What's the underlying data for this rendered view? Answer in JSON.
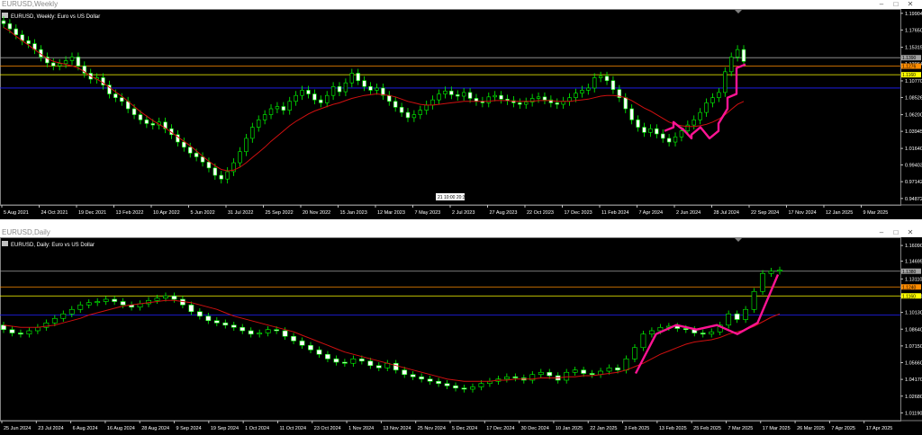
{
  "windows": [
    {
      "id": "weekly",
      "title": "EURUSD,Weekly",
      "chart_label": "EURUSD, Weekly:  Euro vs US Dollar",
      "price_labels": [
        "1.19904",
        "1.17650",
        "1.15315",
        "1.13064",
        "1.10770",
        "1.08526",
        "1.06200",
        "1.03945",
        "1.01640",
        "0.99403",
        "0.97142",
        "0.94872"
      ],
      "ylim": [
        0.94,
        1.2
      ],
      "levels": [
        {
          "price": 1.139,
          "color": "#a0a0a0",
          "tag": "1.1390"
        },
        {
          "price": 1.1276,
          "color": "#ff8c00",
          "tag": "1.1276"
        },
        {
          "price": 1.116,
          "color": "#ffff00",
          "tag": "1.1160"
        },
        {
          "price": 1.098,
          "color": "#2020ff",
          "tag": ""
        }
      ],
      "date_labels": [
        "5 Aug 2021",
        "24 Oct 2021",
        "19 Dec 2021",
        "13 Feb 2022",
        "10 Apr 2022",
        "5 Jun 2022",
        "31 Jul 2022",
        "25 Sep 2022",
        "20 Nov 2022",
        "15 Jan 2023",
        "12 Mar 2023",
        "7 May 2023",
        "2 Jul 2023",
        "27 Aug 2023",
        "22 Oct 2023",
        "17 Dec 2023",
        "11 Feb 2024",
        "7 Apr 2024",
        "2 Jun 2024",
        "28 Jul 2024",
        "22 Sep 2024",
        "17 Nov 2024",
        "12 Jan 2025",
        "9 Mar 2025"
      ],
      "crosshair_tag": "21 10:00  20:30",
      "chart_data": {
        "type": "candlestick",
        "series": [
          {
            "name": "EURUSD close",
            "values": [
              1.185,
              1.178,
              1.17,
              1.162,
              1.158,
              1.15,
              1.14,
              1.132,
              1.128,
              1.131,
              1.135,
              1.14,
              1.128,
              1.118,
              1.11,
              1.112,
              1.102,
              1.09,
              1.085,
              1.08,
              1.07,
              1.062,
              1.055,
              1.05,
              1.048,
              1.052,
              1.043,
              1.035,
              1.025,
              1.018,
              1.01,
              1.005,
              0.998,
              0.99,
              0.98,
              0.975,
              0.985,
              0.997,
              1.012,
              1.03,
              1.045,
              1.055,
              1.062,
              1.07,
              1.073,
              1.068,
              1.08,
              1.088,
              1.095,
              1.09,
              1.082,
              1.078,
              1.088,
              1.1,
              1.093,
              1.105,
              1.118,
              1.108,
              1.1,
              1.095,
              1.098,
              1.088,
              1.08,
              1.072,
              1.065,
              1.058,
              1.062,
              1.068,
              1.075,
              1.082,
              1.09,
              1.094,
              1.089,
              1.087,
              1.092,
              1.084,
              1.08,
              1.078,
              1.086,
              1.088,
              1.083,
              1.081,
              1.078,
              1.076,
              1.079,
              1.084,
              1.086,
              1.082,
              1.078,
              1.076,
              1.08,
              1.085,
              1.091,
              1.095,
              1.098,
              1.112,
              1.114,
              1.108,
              1.096,
              1.085,
              1.07,
              1.055,
              1.045,
              1.038,
              1.043,
              1.036,
              1.03,
              1.025,
              1.032,
              1.04,
              1.048,
              1.055,
              1.065,
              1.078,
              1.085,
              1.092,
              1.12,
              1.14,
              1.15,
              1.134
            ]
          },
          {
            "name": "MA",
            "values": [
              1.18,
              1.175,
              1.168,
              1.162,
              1.156,
              1.15,
              1.144,
              1.138,
              1.134,
              1.132,
              1.13,
              1.128,
              1.125,
              1.12,
              1.114,
              1.11,
              1.105,
              1.099,
              1.093,
              1.087,
              1.08,
              1.073,
              1.066,
              1.06,
              1.054,
              1.049,
              1.044,
              1.038,
              1.032,
              1.026,
              1.02,
              1.013,
              1.006,
              0.999,
              0.993,
              0.988,
              0.986,
              0.987,
              0.991,
              0.997,
              1.004,
              1.011,
              1.018,
              1.026,
              1.033,
              1.04,
              1.047,
              1.053,
              1.058,
              1.063,
              1.067,
              1.07,
              1.073,
              1.076,
              1.078,
              1.081,
              1.084,
              1.086,
              1.088,
              1.089,
              1.09,
              1.089,
              1.088,
              1.086,
              1.083,
              1.08,
              1.078,
              1.076,
              1.075,
              1.075,
              1.076,
              1.077,
              1.078,
              1.079,
              1.08,
              1.08,
              1.08,
              1.08,
              1.08,
              1.081,
              1.081,
              1.081,
              1.08,
              1.08,
              1.08,
              1.08,
              1.081,
              1.081,
              1.081,
              1.08,
              1.08,
              1.08,
              1.081,
              1.082,
              1.083,
              1.085,
              1.087,
              1.088,
              1.088,
              1.087,
              1.085,
              1.081,
              1.076,
              1.071,
              1.067,
              1.062,
              1.057,
              1.052,
              1.049,
              1.047,
              1.046,
              1.046,
              1.047,
              1.049,
              1.052,
              1.056,
              1.062,
              1.069,
              1.076,
              1.08
            ]
          }
        ],
        "drawing": [
          [
            1.04,
            1.045
          ],
          [
            1.052,
            1.042
          ],
          [
            1.043,
            1.03
          ],
          [
            1.035,
            1.045
          ],
          [
            1.045,
            1.03
          ],
          [
            1.03,
            1.04
          ],
          [
            1.05,
            1.07
          ],
          [
            1.085,
            1.09
          ],
          [
            1.125,
            1.13
          ]
        ]
      }
    },
    {
      "id": "daily",
      "title": "EURUSD,Daily",
      "chart_label": "EURUSD, Daily:  Euro vs US Dollar",
      "price_labels": [
        "1.16090",
        "1.14695",
        "1.13110",
        "1.11580",
        "1.10130",
        "1.08640",
        "1.07150",
        "1.05660",
        "1.04170",
        "1.02680",
        "1.01190"
      ],
      "ylim": [
        1.005,
        1.165
      ],
      "levels": [
        {
          "price": 1.138,
          "color": "#a0a0a0",
          "tag": "1.1380"
        },
        {
          "price": 1.124,
          "color": "#ff8c00",
          "tag": "1.1240"
        },
        {
          "price": 1.116,
          "color": "#ffff00",
          "tag": "1.1160"
        },
        {
          "price": 1.099,
          "color": "#2020ff",
          "tag": ""
        }
      ],
      "date_labels": [
        "25 Jun 2024",
        "23 Jul 2024",
        "6 Aug 2024",
        "16 Aug 2024",
        "28 Aug 2024",
        "9 Sep 2024",
        "19 Sep 2024",
        "1 Oct 2024",
        "11 Oct 2024",
        "23 Oct 2024",
        "1 Nov 2024",
        "13 Nov 2024",
        "25 Nov 2024",
        "5 Dec 2024",
        "17 Dec 2024",
        "30 Dec 2024",
        "10 Jan 2025",
        "22 Jan 2025",
        "3 Feb 2025",
        "13 Feb 2025",
        "25 Feb 2025",
        "7 Mar 2025",
        "17 Mar 2025",
        "26 Mar 2025",
        "7 Apr 2025",
        "17 Apr 2025"
      ],
      "chart_data": {
        "type": "candlestick",
        "series": [
          {
            "name": "EURUSD close",
            "values": [
              1.086,
              1.083,
              1.082,
              1.085,
              1.088,
              1.092,
              1.096,
              1.1,
              1.104,
              1.108,
              1.11,
              1.111,
              1.113,
              1.111,
              1.108,
              1.106,
              1.109,
              1.112,
              1.114,
              1.116,
              1.113,
              1.108,
              1.102,
              1.098,
              1.094,
              1.092,
              1.09,
              1.088,
              1.085,
              1.082,
              1.083,
              1.086,
              1.085,
              1.08,
              1.076,
              1.072,
              1.068,
              1.064,
              1.06,
              1.057,
              1.056,
              1.06,
              1.058,
              1.054,
              1.052,
              1.056,
              1.05,
              1.046,
              1.044,
              1.042,
              1.04,
              1.038,
              1.036,
              1.034,
              1.033,
              1.035,
              1.038,
              1.04,
              1.042,
              1.044,
              1.043,
              1.041,
              1.046,
              1.048,
              1.045,
              1.041,
              1.048,
              1.05,
              1.047,
              1.046,
              1.049,
              1.052,
              1.05,
              1.06,
              1.07,
              1.082,
              1.085,
              1.088,
              1.089,
              1.087,
              1.086,
              1.083,
              1.082,
              1.084,
              1.09,
              1.1,
              1.095,
              1.104,
              1.12,
              1.136,
              1.138,
              1.139
            ]
          },
          {
            "name": "MA",
            "values": [
              1.09,
              1.089,
              1.088,
              1.088,
              1.088,
              1.089,
              1.09,
              1.092,
              1.094,
              1.096,
              1.099,
              1.101,
              1.103,
              1.105,
              1.107,
              1.108,
              1.109,
              1.11,
              1.111,
              1.112,
              1.112,
              1.111,
              1.11,
              1.108,
              1.106,
              1.104,
              1.101,
              1.098,
              1.096,
              1.094,
              1.092,
              1.09,
              1.088,
              1.086,
              1.084,
              1.081,
              1.078,
              1.075,
              1.072,
              1.069,
              1.066,
              1.064,
              1.062,
              1.06,
              1.058,
              1.056,
              1.054,
              1.052,
              1.05,
              1.048,
              1.046,
              1.044,
              1.042,
              1.041,
              1.04,
              1.04,
              1.04,
              1.04,
              1.041,
              1.041,
              1.042,
              1.042,
              1.042,
              1.043,
              1.043,
              1.043,
              1.044,
              1.044,
              1.045,
              1.045,
              1.046,
              1.047,
              1.048,
              1.05,
              1.053,
              1.056,
              1.06,
              1.064,
              1.067,
              1.07,
              1.073,
              1.075,
              1.076,
              1.077,
              1.079,
              1.082,
              1.084,
              1.086,
              1.089,
              1.093,
              1.097,
              1.1
            ]
          }
        ],
        "drawing": [
          [
            1.047,
            1.082
          ],
          [
            1.082,
            1.09
          ],
          [
            1.09,
            1.086
          ],
          [
            1.086,
            1.09
          ],
          [
            1.09,
            1.082
          ],
          [
            1.082,
            1.092
          ],
          [
            1.092,
            1.135
          ]
        ]
      }
    }
  ]
}
